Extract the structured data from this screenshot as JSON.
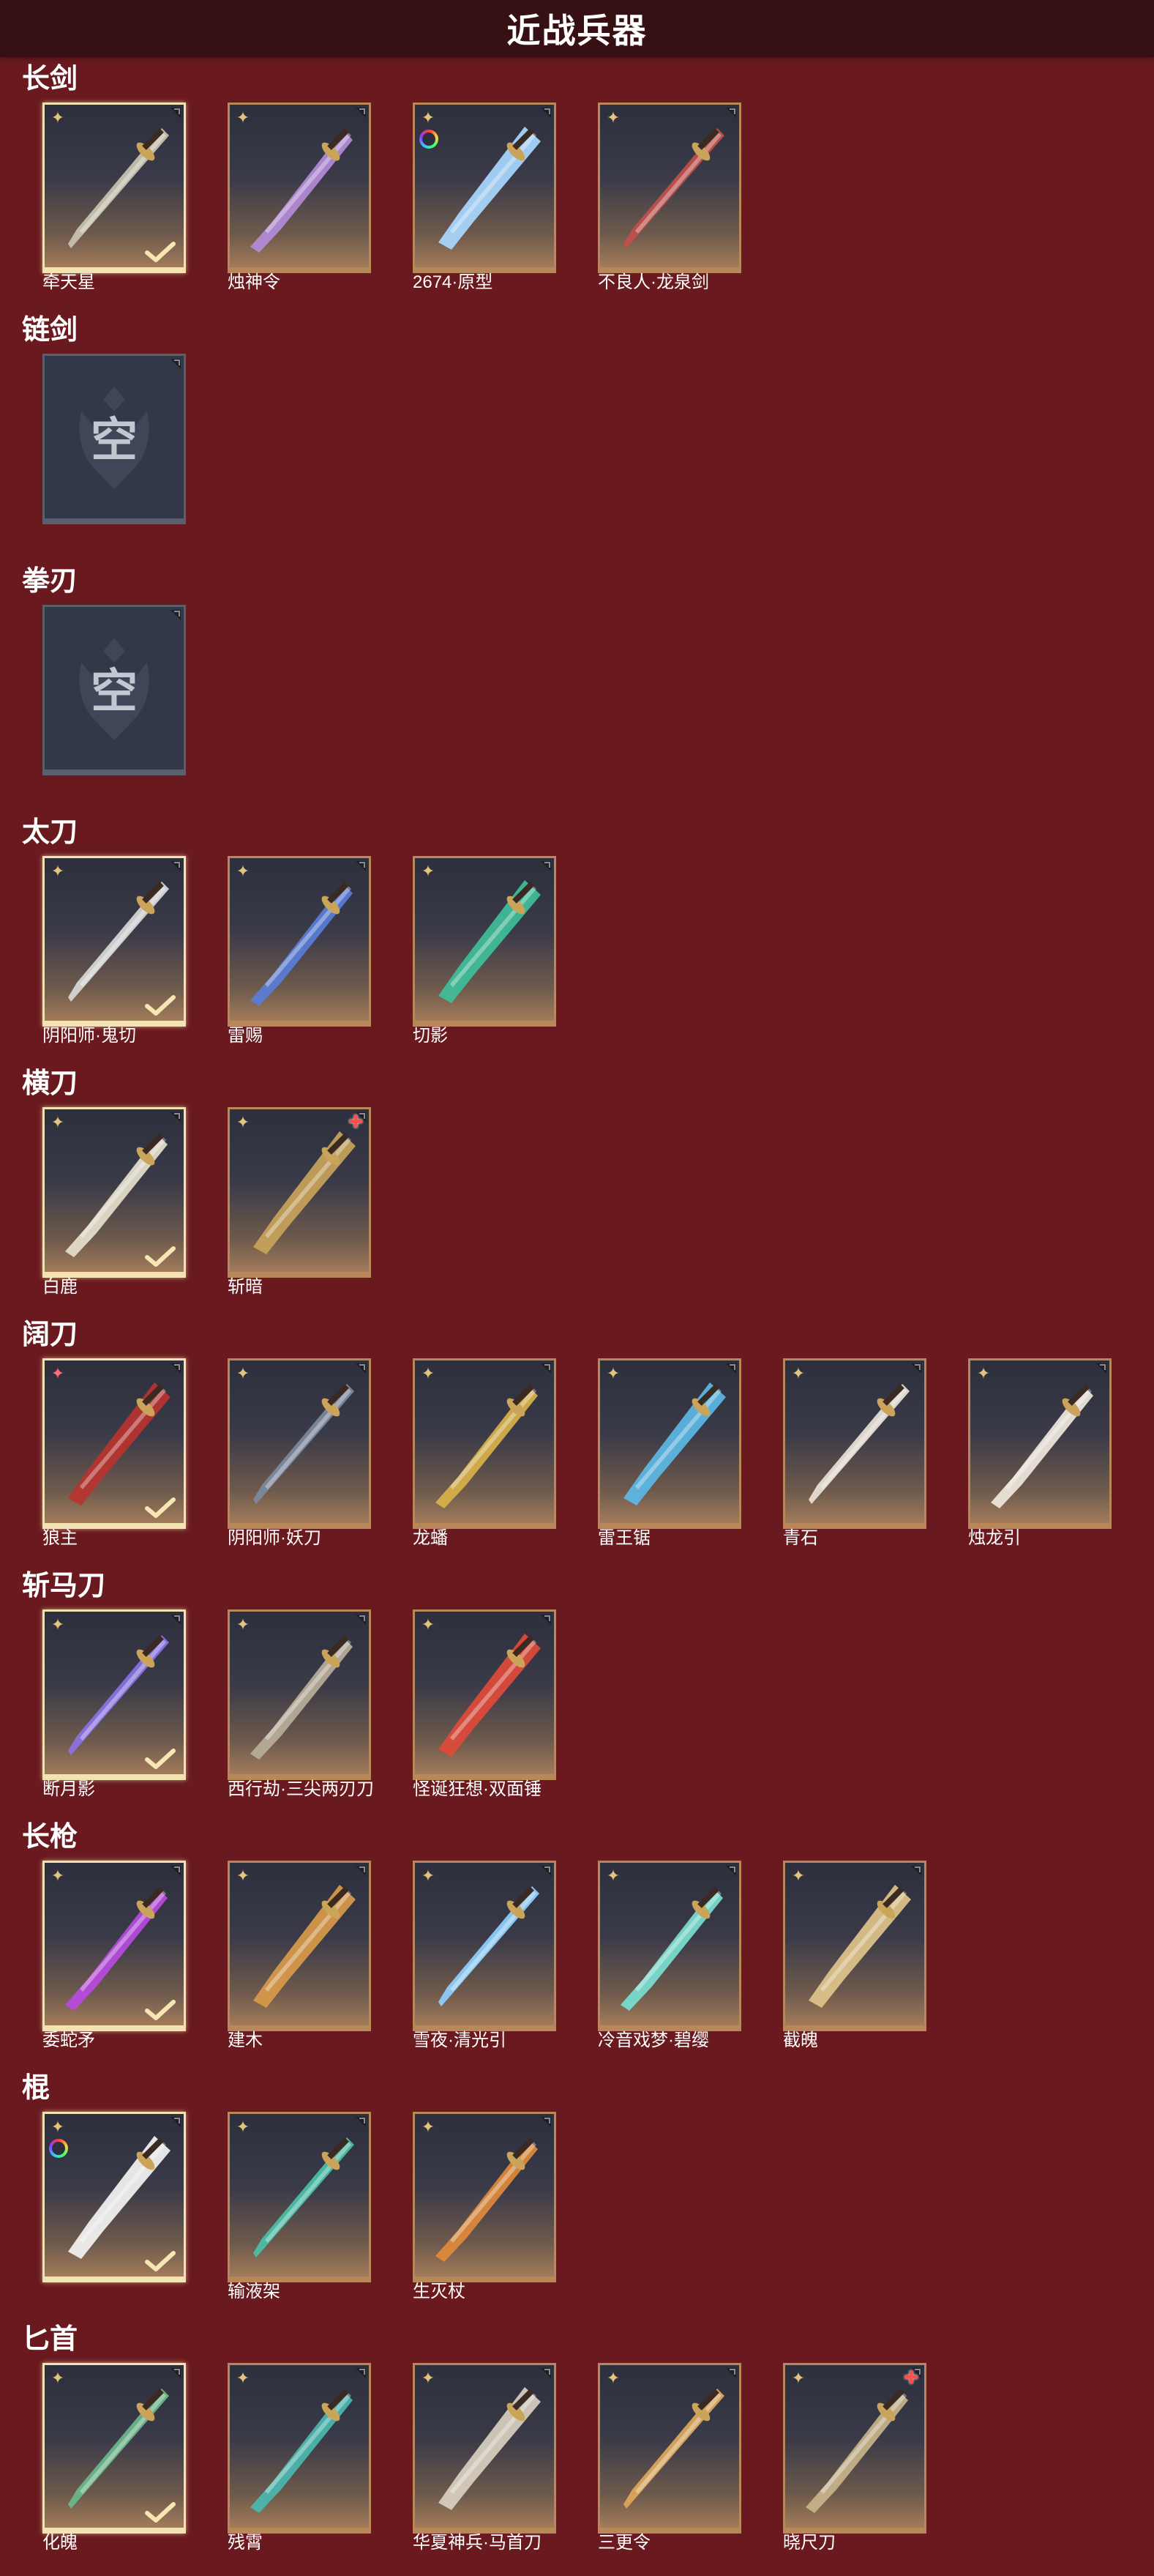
{
  "header": {
    "title": "近战兵器"
  },
  "colors": {
    "background": "#6a1a1e",
    "header_bg": "#371013",
    "card_border": "#b9885a",
    "selected_border": "#f3e3b2",
    "empty_card": "#323848"
  },
  "sections": [
    {
      "label": "长剑",
      "items": [
        {
          "name": "牵天星",
          "selected": true,
          "rarity_icon": "star-icon",
          "tint": "#c9c3b0"
        },
        {
          "name": "烛神令",
          "selected": false,
          "rarity_icon": "star-icon",
          "tint": "#b48bd8"
        },
        {
          "name": "2674·原型",
          "selected": false,
          "rarity_icon": "star-icon",
          "rainbow": true,
          "tint": "#a9d8ff"
        },
        {
          "name": "不良人·龙泉剑",
          "selected": false,
          "rarity_icon": "star-icon",
          "tint": "#c0504a"
        }
      ]
    },
    {
      "label": "链剑",
      "items": [
        {
          "name": "",
          "empty": true,
          "empty_text": "空"
        }
      ]
    },
    {
      "label": "拳刃",
      "items": [
        {
          "name": "",
          "empty": true,
          "empty_text": "空"
        }
      ]
    },
    {
      "label": "太刀",
      "items": [
        {
          "name": "阴阳师·鬼切",
          "selected": true,
          "rarity_icon": "star-icon",
          "tint": "#d8d8d8"
        },
        {
          "name": "雷赐",
          "selected": false,
          "rarity_icon": "star-icon",
          "tint": "#5a7dd8"
        },
        {
          "name": "切影",
          "selected": false,
          "rarity_icon": "star-icon",
          "tint": "#3fbf9a"
        }
      ]
    },
    {
      "label": "横刀",
      "items": [
        {
          "name": "白鹿",
          "selected": true,
          "rarity_icon": "star-icon",
          "tint": "#e6dfcc"
        },
        {
          "name": "斩暗",
          "selected": false,
          "rarity_icon": "star-icon",
          "gem": true,
          "tint": "#c8a35a"
        }
      ]
    },
    {
      "label": "阔刀",
      "items": [
        {
          "name": "狼主",
          "selected": true,
          "rarity_icon": "star-icon",
          "pink": true,
          "tint": "#b8332f"
        },
        {
          "name": "阴阳师·妖刀",
          "selected": false,
          "rarity_icon": "star-icon",
          "tint": "#7d8aa0"
        },
        {
          "name": "龙蟠",
          "selected": false,
          "rarity_icon": "star-icon",
          "tint": "#d9b24a"
        },
        {
          "name": "雷王锯",
          "selected": false,
          "rarity_icon": "star-icon",
          "tint": "#5cb8e6"
        },
        {
          "name": "青石",
          "selected": false,
          "rarity_icon": "star-icon",
          "tint": "#e8e2d6"
        },
        {
          "name": "烛龙引",
          "selected": false,
          "rarity_icon": "star-icon",
          "tint": "#efe8dc"
        }
      ]
    },
    {
      "label": "斩马刀",
      "items": [
        {
          "name": "断月影",
          "selected": true,
          "rarity_icon": "star-icon",
          "tint": "#8a72e6"
        },
        {
          "name": "西行劫·三尖两刃刀",
          "selected": false,
          "rarity_icon": "star-icon",
          "tint": "#b8ae9a"
        },
        {
          "name": "怪诞狂想·双面锤",
          "selected": false,
          "rarity_icon": "star-icon",
          "tint": "#e04a3a"
        }
      ]
    },
    {
      "label": "长枪",
      "items": [
        {
          "name": "委蛇矛",
          "selected": true,
          "rarity_icon": "star-icon",
          "tint": "#b84ae0"
        },
        {
          "name": "建木",
          "selected": false,
          "rarity_icon": "star-icon",
          "tint": "#d99a4a"
        },
        {
          "name": "雪夜·清光引",
          "selected": false,
          "rarity_icon": "star-icon",
          "tint": "#8fd0ff"
        },
        {
          "name": "冷音戏梦·碧缨",
          "selected": false,
          "rarity_icon": "star-icon",
          "tint": "#7ae0d0"
        },
        {
          "name": "截魄",
          "selected": false,
          "rarity_icon": "star-icon",
          "tint": "#e0c48a"
        }
      ]
    },
    {
      "label": "棍",
      "items": [
        {
          "name": "",
          "selected": true,
          "rarity_icon": "star-icon",
          "rainbow": true,
          "tint": "#f4f4f4"
        },
        {
          "name": "输液架",
          "selected": false,
          "rarity_icon": "star-icon",
          "tint": "#4ac0a8"
        },
        {
          "name": "生灭杖",
          "selected": false,
          "rarity_icon": "star-icon",
          "tint": "#e08a3a"
        }
      ]
    },
    {
      "label": "匕首",
      "items": [
        {
          "name": "化魄",
          "selected": true,
          "rarity_icon": "star-icon",
          "tint": "#6ab88a"
        },
        {
          "name": "残霄",
          "selected": false,
          "rarity_icon": "star-icon",
          "tint": "#4ab8b0"
        },
        {
          "name": "华夏神兵·马首刀",
          "selected": false,
          "rarity_icon": "star-icon",
          "tint": "#d8d0c0"
        },
        {
          "name": "三更令",
          "selected": false,
          "rarity_icon": "star-icon",
          "tint": "#e0a85a"
        },
        {
          "name": "晓尺刀",
          "selected": false,
          "rarity_icon": "star-icon",
          "gem": true,
          "tint": "#c8b48a"
        }
      ]
    }
  ]
}
